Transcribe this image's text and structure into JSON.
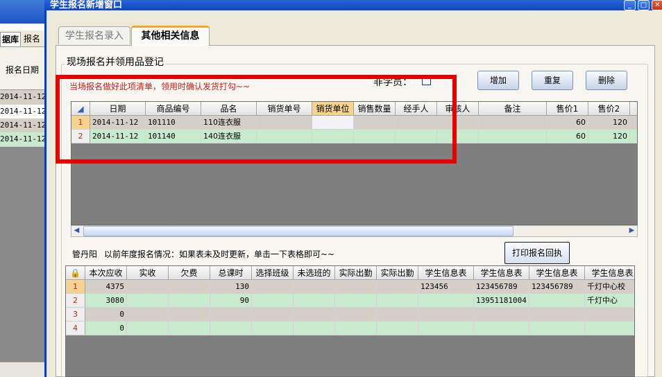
{
  "background_window": {
    "tabs": [
      "据库",
      "报名"
    ],
    "header_label": "报名日期",
    "dates": [
      "2014-11-12",
      "2014-11-12",
      "2014-11-12",
      "2014-11-12"
    ]
  },
  "dialog": {
    "title": "学生报名新增窗口",
    "controls": {
      "minimize": "_",
      "maximize": "□",
      "close": "✕"
    },
    "tabs": [
      {
        "label": "学生报名录入",
        "active": false
      },
      {
        "label": "其他相关信息",
        "active": true
      }
    ]
  },
  "onsite": {
    "group_title": "现场报名并领用品登记",
    "hint": "当场报名做好此项清单，领用时确认发货打勾~~",
    "non_student_label": "非学员：",
    "non_student_checked": false,
    "buttons": {
      "add": "增加",
      "reset": "重复",
      "delete": "删除"
    }
  },
  "grid1": {
    "columns": [
      "日期",
      "商品编号",
      "品名",
      "销货单号",
      "销货单位",
      "销售数量",
      "经手人",
      "审核人",
      "备注",
      "售价1",
      "售价2"
    ],
    "selected_column": "销货单位",
    "rows": [
      {
        "no": "1",
        "cells": [
          "2014-11-12",
          "101110",
          "110连衣服",
          "",
          "",
          "",
          "",
          "",
          "",
          "60",
          "120"
        ]
      },
      {
        "no": "2",
        "cells": [
          "2014-11-12",
          "101140",
          "140连衣服",
          "",
          "",
          "",
          "",
          "",
          "",
          "60",
          "120"
        ]
      }
    ],
    "scroll_left_icon": "arrow-left",
    "scroll_right_icon": "arrow-right"
  },
  "history": {
    "name_label": "管丹阳",
    "hint": "以前年度报名情况：如果表未及时更新，单击一下表格即可~~",
    "print_button": "打印报名回执"
  },
  "grid2": {
    "corner_icon": "lock-icon",
    "columns": [
      "本次应收",
      "实收",
      "欠费",
      "总课时",
      "选择班级",
      "未选班的",
      "实际出勤",
      "实际出勤",
      "学生信息表",
      "学生信息表",
      "学生信息表",
      "学生信息表"
    ],
    "rows": [
      {
        "no": "1",
        "cells": [
          "4375",
          "",
          "",
          "130",
          "",
          "",
          "",
          "",
          "123456",
          "123456789",
          "123456789",
          "千灯中心校"
        ]
      },
      {
        "no": "2",
        "cells": [
          "3080",
          "",
          "",
          "90",
          "",
          "",
          "",
          "",
          "",
          "13951181004",
          "",
          "千灯中心"
        ]
      },
      {
        "no": "3",
        "cells": [
          "0",
          "",
          "",
          "",
          "",
          "",
          "",
          "",
          "",
          "",
          "",
          ""
        ]
      },
      {
        "no": "4",
        "cells": [
          "0",
          "",
          "",
          "",
          "",
          "",
          "",
          "",
          "",
          "",
          "",
          ""
        ]
      }
    ]
  },
  "colors": {
    "row_even": "#d4d0c8",
    "row_odd": "#c7ebcc",
    "highlight_box": "#e60000",
    "hint_text": "#cc1f1f",
    "active_tab_accent": "#f5a623"
  }
}
